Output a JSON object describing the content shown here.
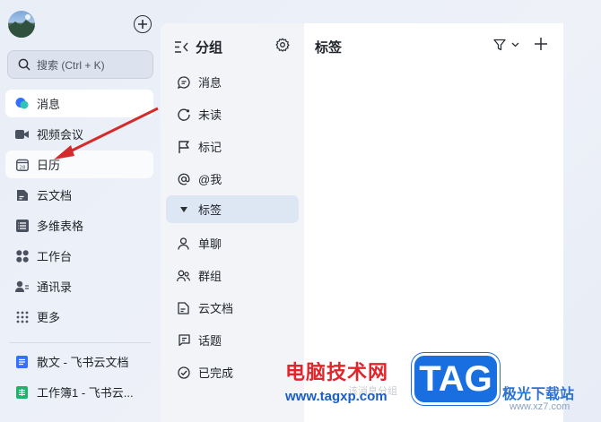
{
  "sidebar": {
    "search_placeholder": "搜索 (Ctrl + K)",
    "items": [
      {
        "label": "消息",
        "icon": "chat-bubble-icon",
        "active": true
      },
      {
        "label": "视频会议",
        "icon": "video-camera-icon"
      },
      {
        "label": "日历",
        "icon": "calendar-icon",
        "hover": true
      },
      {
        "label": "云文档",
        "icon": "cloud-doc-icon"
      },
      {
        "label": "多维表格",
        "icon": "table-icon"
      },
      {
        "label": "工作台",
        "icon": "grid-apps-icon"
      },
      {
        "label": "通讯录",
        "icon": "contacts-icon"
      },
      {
        "label": "更多",
        "icon": "more-dots-icon"
      }
    ],
    "pinned": [
      {
        "label": "散文 - 飞书云文档",
        "icon": "doc-icon"
      },
      {
        "label": "工作簿1 - 飞书云...",
        "icon": "sheet-icon"
      }
    ]
  },
  "groups": {
    "title": "分组",
    "items": [
      {
        "label": "消息",
        "icon": "message-icon"
      },
      {
        "label": "未读",
        "icon": "unread-icon"
      },
      {
        "label": "标记",
        "icon": "flag-icon"
      },
      {
        "label": "@我",
        "icon": "at-icon"
      },
      {
        "label": "标签",
        "icon": "triangle-down-icon",
        "active": true
      },
      {
        "label": "单聊",
        "icon": "person-icon"
      },
      {
        "label": "群组",
        "icon": "group-icon"
      },
      {
        "label": "云文档",
        "icon": "cloud-doc-icon"
      },
      {
        "label": "话题",
        "icon": "topic-icon"
      },
      {
        "label": "已完成",
        "icon": "check-circle-icon"
      }
    ]
  },
  "panel": {
    "title": "标签"
  },
  "watermark": {
    "brand": "电脑技术网",
    "url": "www.tagxp.com",
    "tag": "TAG",
    "site": "极光下载站",
    "site_url": "www.xz7.com",
    "faint_text": "该消息分组",
    "faint_text2": "文"
  },
  "colors": {
    "accent": "#3370ff",
    "arrow": "#d42a2a",
    "active_group": "#dde6f3"
  }
}
